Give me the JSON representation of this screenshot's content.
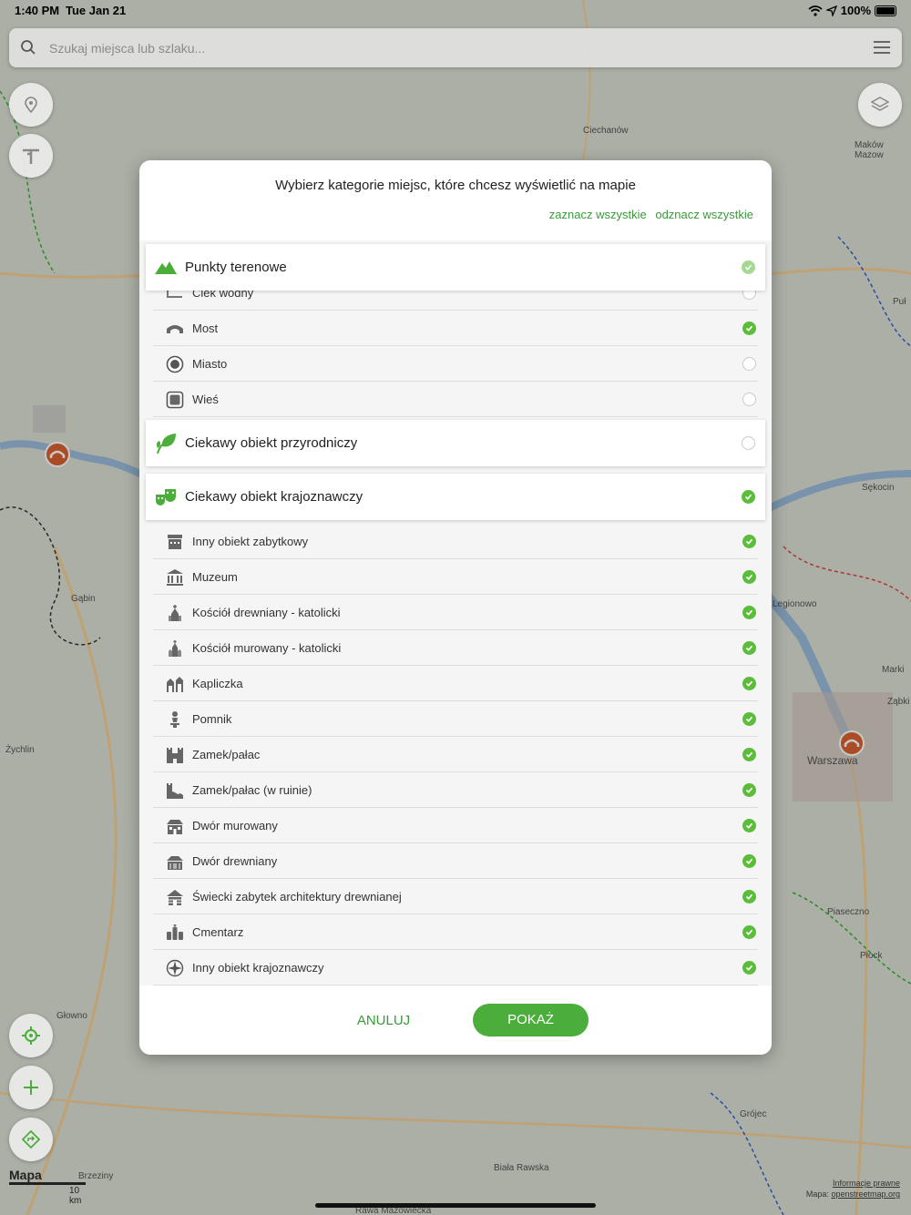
{
  "status_bar": {
    "time": "1:40 PM",
    "date": "Tue Jan 21",
    "battery": "100%"
  },
  "search": {
    "placeholder": "Szukaj miejsca lub szlaku..."
  },
  "map": {
    "labels": [
      "Ciechanów",
      "Maków Mazow",
      "Puł",
      "Żychlin",
      "Sękocin",
      "Marki",
      "Ząbki",
      "Warszawa",
      "Piaseczno",
      "Płock",
      "Głowno",
      "Grójec",
      "Biała Rawska",
      "Brzeziny",
      "Rawa Mazowiecka",
      "Gąbin",
      "Legionowo"
    ],
    "scale_label": "10 km",
    "logo": "Mapa",
    "legal_link": "Informacje prawne",
    "attribution_prefix": "Mapa:",
    "attribution_link": "openstreetmap.org"
  },
  "dialog": {
    "title": "Wybierz kategorie miejsc, które chcesz wyświetlić na mapie",
    "select_all": "zaznacz wszystkie",
    "deselect_all": "odznacz wszystkie",
    "categories": [
      {
        "label": "Punkty terenowe",
        "icon": "mountain-icon",
        "checked": true,
        "items": [
          {
            "label": "Ciek wodny",
            "icon": "stream-icon",
            "checked": false
          },
          {
            "label": "Most",
            "icon": "bridge-icon",
            "checked": true
          },
          {
            "label": "Miasto",
            "icon": "city-icon",
            "checked": false
          },
          {
            "label": "Wieś",
            "icon": "village-icon",
            "checked": false
          }
        ]
      },
      {
        "label": "Ciekawy obiekt przyrodniczy",
        "icon": "leaf-icon",
        "checked": false,
        "items": []
      },
      {
        "label": "Ciekawy obiekt krajoznawczy",
        "icon": "theater-masks-icon",
        "checked": true,
        "items": [
          {
            "label": "Inny obiekt zabytkowy",
            "icon": "monument-icon",
            "checked": true
          },
          {
            "label": "Muzeum",
            "icon": "museum-icon",
            "checked": true
          },
          {
            "label": "Kościół drewniany - katolicki",
            "icon": "wooden-church-icon",
            "checked": true
          },
          {
            "label": "Kościół murowany - katolicki",
            "icon": "brick-church-icon",
            "checked": true
          },
          {
            "label": "Kapliczka",
            "icon": "chapel-icon",
            "checked": true
          },
          {
            "label": "Pomnik",
            "icon": "statue-icon",
            "checked": true
          },
          {
            "label": "Zamek/pałac",
            "icon": "castle-icon",
            "checked": true
          },
          {
            "label": "Zamek/pałac (w ruinie)",
            "icon": "castle-ruin-icon",
            "checked": true
          },
          {
            "label": "Dwór murowany",
            "icon": "manor-icon",
            "checked": true
          },
          {
            "label": "Dwór drewniany",
            "icon": "wooden-manor-icon",
            "checked": true
          },
          {
            "label": "Świecki zabytek architektury drewnianej",
            "icon": "wooden-house-icon",
            "checked": true
          },
          {
            "label": "Cmentarz",
            "icon": "cemetery-icon",
            "checked": true
          },
          {
            "label": "Inny obiekt krajoznawczy",
            "icon": "compass-icon",
            "checked": true
          }
        ]
      }
    ],
    "cancel_label": "ANULUJ",
    "show_label": "POKAŻ"
  },
  "colors": {
    "accent": "#4cae3a",
    "check": "#5cbd3b",
    "marker": "#d4541e"
  }
}
